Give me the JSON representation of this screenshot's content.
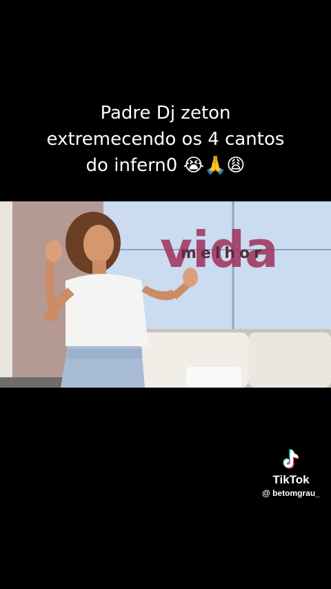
{
  "caption": {
    "line1": "Padre Dj zeton",
    "line2": "extremecendo os 4 cantos",
    "line3": "do infern0 😭🙏😩"
  },
  "video": {
    "backdrop_title": "vida",
    "backdrop_subtitle": "melhor"
  },
  "watermark": {
    "brand": "TikTok",
    "handle": "@ betomgrau_"
  },
  "colors": {
    "background": "#000000",
    "text": "#ffffff",
    "backdrop_title": "#a0305a",
    "tiktok_cyan": "#25f4ee",
    "tiktok_red": "#fe2c55"
  },
  "icons": {
    "watermark_logo": "tiktok-logo-icon"
  }
}
